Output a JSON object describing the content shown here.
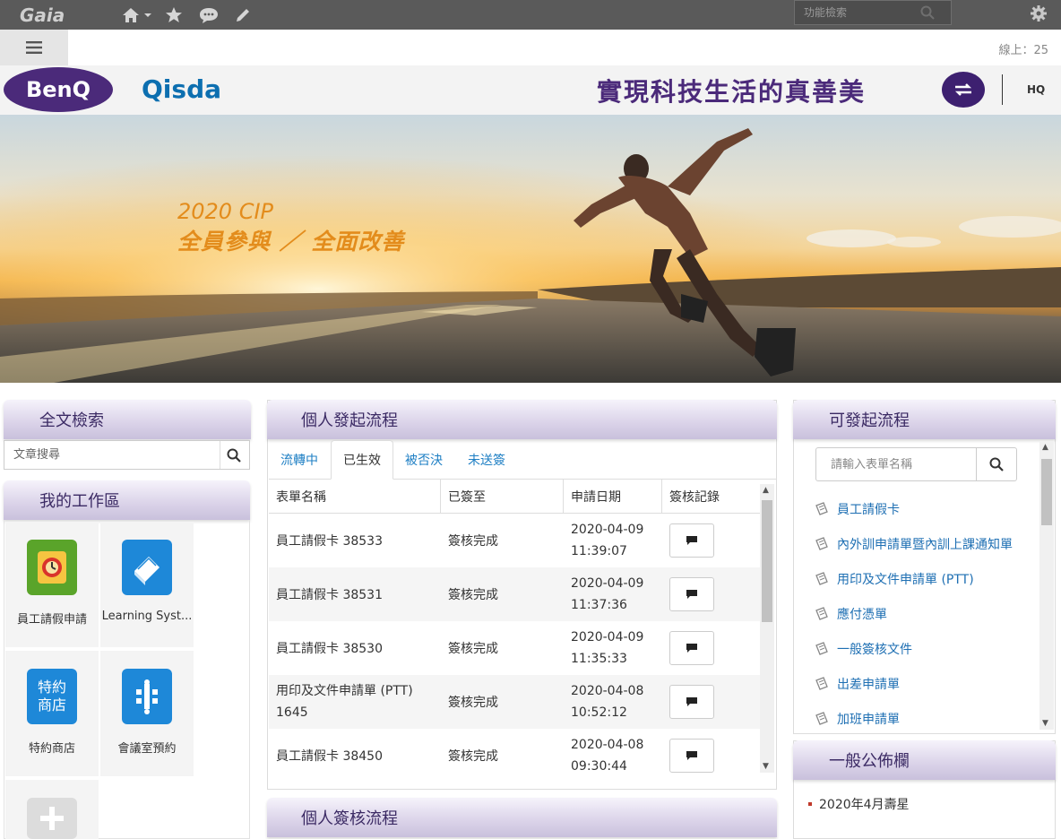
{
  "topbar": {
    "logo": "Gaia",
    "search_placeholder": "功能檢索"
  },
  "secbar": {
    "online_label": "線上：25"
  },
  "brand": {
    "benq": "BenQ",
    "qisda": "Qisda",
    "slogan": "實現科技生活的真善美",
    "hq": "HQ"
  },
  "banner": {
    "line1": "2020 CIP",
    "line2": "全員參與 ／ 全面改善"
  },
  "left": {
    "search_title": "全文檢索",
    "search_placeholder": "文章搜尋",
    "workspace_title": "我的工作區",
    "tiles": [
      {
        "label": "員工請假申請",
        "icon": "leave-app-icon",
        "color": "#5aa42a"
      },
      {
        "label": "Learning Syst...",
        "icon": "book-icon",
        "color": "#1e88d8"
      },
      {
        "label": "特約商店",
        "icon_text": "特約\n商店",
        "icon": "store-icon",
        "color": "#1e88d8"
      },
      {
        "label": "會議室預約",
        "icon": "meeting-room-icon",
        "color": "#1e88d8"
      }
    ]
  },
  "center": {
    "title": "個人發起流程",
    "tabs": [
      "流轉中",
      "已生效",
      "被否決",
      "未送簽"
    ],
    "active_tab": "已生效",
    "columns": [
      "表單名稱",
      "已簽至",
      "申請日期",
      "簽核記錄"
    ],
    "rows": [
      {
        "name": "員工請假卡 38533",
        "status": "簽核完成",
        "date": "2020-04-09",
        "time": "11:39:07"
      },
      {
        "name": "員工請假卡 38531",
        "status": "簽核完成",
        "date": "2020-04-09",
        "time": "11:37:36"
      },
      {
        "name": "員工請假卡 38530",
        "status": "簽核完成",
        "date": "2020-04-09",
        "time": "11:35:33"
      },
      {
        "name": "用印及文件申請單 (PTT) 1645",
        "status": "簽核完成",
        "date": "2020-04-08",
        "time": "10:52:12"
      },
      {
        "name": "員工請假卡 38450",
        "status": "簽核完成",
        "date": "2020-04-08",
        "time": "09:30:44"
      }
    ],
    "bottom_title": "個人簽核流程"
  },
  "right": {
    "title": "可發起流程",
    "search_placeholder": "請輸入表單名稱",
    "flows": [
      "員工請假卡",
      "內外訓申請單暨內訓上課通知單",
      "用印及文件申請單 (PTT)",
      "應付憑單",
      "一般簽核文件",
      "出差申請單",
      "加班申請單"
    ],
    "notice_title": "一般公佈欄",
    "notices": [
      "2020年4月壽星"
    ]
  },
  "colors": {
    "topbar": "#5a5a5a",
    "panel_header": "#dcd5ea",
    "link": "#1e7fc4",
    "brand_purple": "#4b2a7a",
    "qisda_blue": "#0d6fb0",
    "banner_text": "#e38c1c"
  }
}
